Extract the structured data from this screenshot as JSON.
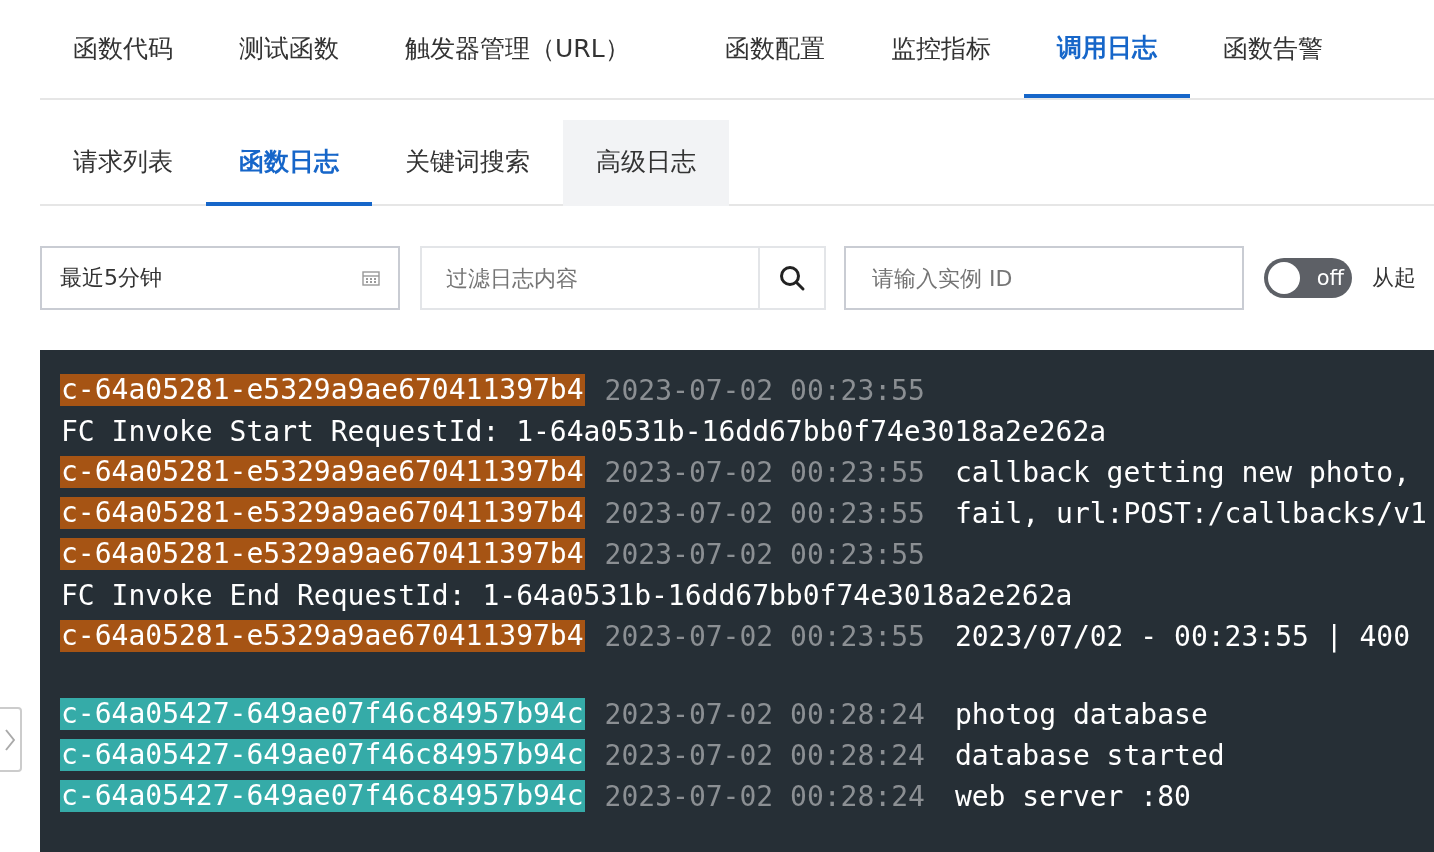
{
  "tabs": [
    {
      "label": "函数代码",
      "selected": false
    },
    {
      "label": "测试函数",
      "selected": false
    },
    {
      "label": "触发器管理（URL）",
      "selected": false
    },
    {
      "label": "函数配置",
      "selected": false
    },
    {
      "label": "监控指标",
      "selected": false
    },
    {
      "label": "调用日志",
      "selected": true
    },
    {
      "label": "函数告警",
      "selected": false
    }
  ],
  "subtabs": [
    {
      "label": "请求列表",
      "selected": false,
      "highlighted": false
    },
    {
      "label": "函数日志",
      "selected": true,
      "highlighted": false
    },
    {
      "label": "关键词搜索",
      "selected": false,
      "highlighted": false
    },
    {
      "label": "高级日志",
      "selected": false,
      "highlighted": true
    }
  ],
  "filters": {
    "time_range": {
      "value": "最近5分钟"
    },
    "content": {
      "placeholder": "过滤日志内容"
    },
    "instance": {
      "placeholder": "请输入实例 ID"
    },
    "toggle": {
      "on": false,
      "text": "off"
    },
    "toggle_label": "从起"
  },
  "log_groups": [
    {
      "lines": [
        {
          "kind": "instance",
          "instance": "c-64a05281-e5329a9ae670411397b4",
          "color": "#a65414",
          "time": "2023-07-02 00:23:55"
        },
        {
          "kind": "plain",
          "message": "FC Invoke Start RequestId: 1-64a0531b-16dd67bb0f74e3018a2e262a"
        },
        {
          "kind": "instance",
          "instance": "c-64a05281-e5329a9ae670411397b4",
          "color": "#a65414",
          "time": "2023-07-02 00:23:55",
          "message": "callback getting new photo,"
        },
        {
          "kind": "instance",
          "instance": "c-64a05281-e5329a9ae670411397b4",
          "color": "#a65414",
          "time": "2023-07-02 00:23:55",
          "message": "fail, url:POST:/callbacks/v1"
        },
        {
          "kind": "instance",
          "instance": "c-64a05281-e5329a9ae670411397b4",
          "color": "#a65414",
          "time": "2023-07-02 00:23:55"
        },
        {
          "kind": "plain",
          "message": "FC Invoke End RequestId: 1-64a0531b-16dd67bb0f74e3018a2e262a"
        },
        {
          "kind": "instance",
          "instance": "c-64a05281-e5329a9ae670411397b4",
          "color": "#a65414",
          "time": "2023-07-02 00:23:55",
          "message": "2023/07/02 - 00:23:55 | 400"
        }
      ]
    },
    {
      "lines": [
        {
          "kind": "instance",
          "instance": "c-64a05427-649ae07f46c84957b94c",
          "color": "#35aba8",
          "time": "2023-07-02 00:28:24",
          "message": "photog database"
        },
        {
          "kind": "instance",
          "instance": "c-64a05427-649ae07f46c84957b94c",
          "color": "#35aba8",
          "time": "2023-07-02 00:28:24",
          "message": "database started"
        },
        {
          "kind": "instance",
          "instance": "c-64a05427-649ae07f46c84957b94c",
          "color": "#35aba8",
          "time": "2023-07-02 00:28:24",
          "message": "web server :80"
        }
      ]
    }
  ]
}
